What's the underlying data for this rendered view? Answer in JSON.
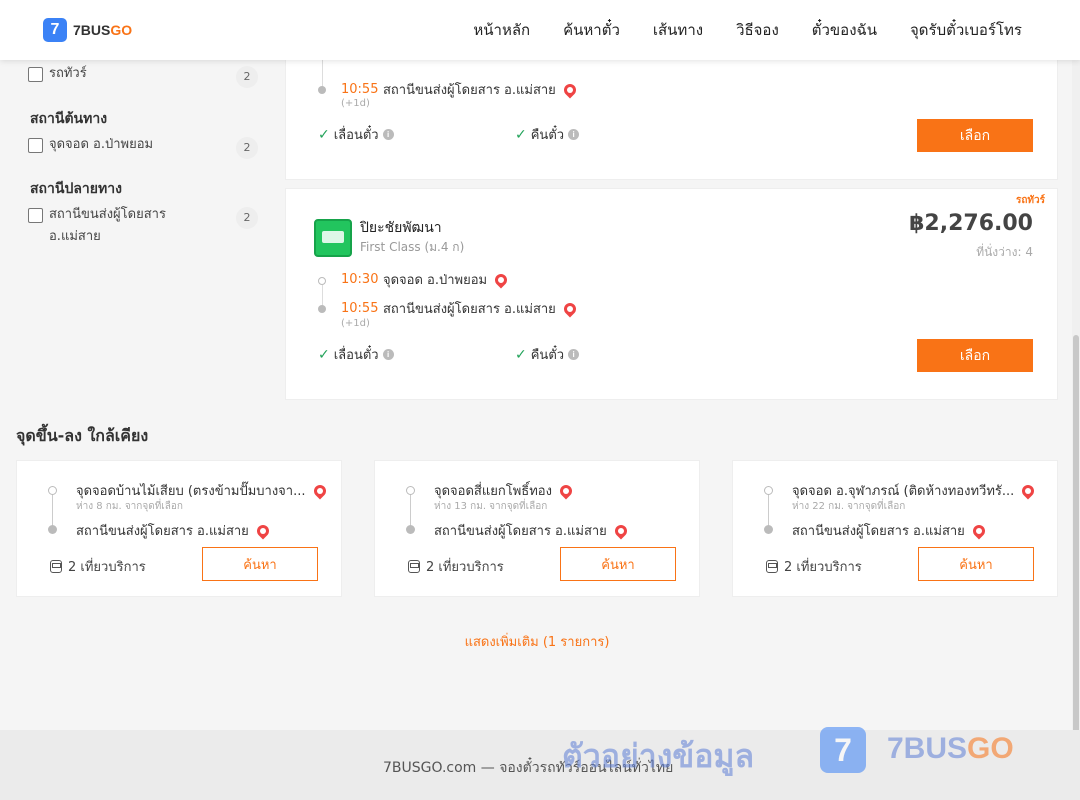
{
  "header": {
    "logo_mark": "7",
    "logo_text": "7BUS",
    "logo_text_accent": "GO",
    "nav": [
      "หน้าหลัก",
      "ค้นหาตั๋ว",
      "เส้นทาง",
      "วิธีจอง",
      "ตั๋วของฉัน",
      "จุดรับตั๋วเบอร์โทร"
    ]
  },
  "sidebar": {
    "type_filter": {
      "label": "รถทัวร์",
      "count": "2"
    },
    "origin_heading": "สถานีต้นทาง",
    "origin_filter": {
      "label": "จุดจอด อ.ป่าพยอม",
      "count": "2"
    },
    "dest_heading": "สถานีปลายทาง",
    "dest_filter": {
      "label": "สถานีขนส่งผู้โดยสาร อ.แม่สาย",
      "count": "2"
    }
  },
  "trips": [
    {
      "arrival_time": "10:55",
      "to": "สถานีขนส่งผู้โดยสาร อ.แม่สาย",
      "plus_day": "(+1d)",
      "change_ticket": "เลื่อนตั๋ว",
      "refund": "คืนตั๋ว",
      "select_label": "เลือก"
    },
    {
      "tag": "รถทัวร์",
      "operator": "ปิยะชัยพัฒนา",
      "bus_class": "First Class (ม.4 ก)",
      "price": "฿2,276.00",
      "seats": "ที่นั่งว่าง: 4",
      "depart_time": "10:30",
      "from": "จุดจอด อ.ป่าพยอม",
      "arrival_time": "10:55",
      "to": "สถานีขนส่งผู้โดยสาร อ.แม่สาย",
      "plus_day": "(+1d)",
      "change_ticket": "เลื่อนตั๋ว",
      "refund": "คืนตั๋ว",
      "select_label": "เลือก"
    }
  ],
  "nearby": {
    "title": "จุดขึ้น-ลง ใกล้เคียง",
    "items": [
      {
        "from": "จุดจอดบ้านไม้เสียบ (ตรงข้ามปั๊มบางจา...",
        "distance": "ห่าง 8 กม. จากจุดที่เลือก",
        "to": "สถานีขนส่งผู้โดยสาร อ.แม่สาย",
        "services": "2 เที่ยวบริการ",
        "button": "ค้นหา"
      },
      {
        "from": "จุดจอดสี่แยกโพธิ์ทอง",
        "distance": "ห่าง 13 กม. จากจุดที่เลือก",
        "to": "สถานีขนส่งผู้โดยสาร อ.แม่สาย",
        "services": "2 เที่ยวบริการ",
        "button": "ค้นหา"
      },
      {
        "from": "จุดจอด อ.จุฬาภรณ์ (ติดห้างทองทวีทรั...",
        "distance": "ห่าง 22 กม. จากจุดที่เลือก",
        "to": "สถานีขนส่งผู้โดยสาร อ.แม่สาย",
        "services": "2 เที่ยวบริการ",
        "button": "ค้นหา"
      }
    ],
    "show_more": "แสดงเพิ่มเติม (1 รายการ)"
  },
  "footer": {
    "text": "7BUSGO.com — จองตั๋วรถทัวร์ออนไลน์ทั่วไทย"
  },
  "watermark": {
    "text": "ตัวอย่างข้อมูล",
    "logo_mark": "7",
    "brand": "7BUS",
    "brand_accent": "GO"
  },
  "colors": {
    "accent": "#f97316",
    "brand_blue": "#3b82f6",
    "check_green": "#22a35a",
    "pin_red": "#ef4444"
  }
}
